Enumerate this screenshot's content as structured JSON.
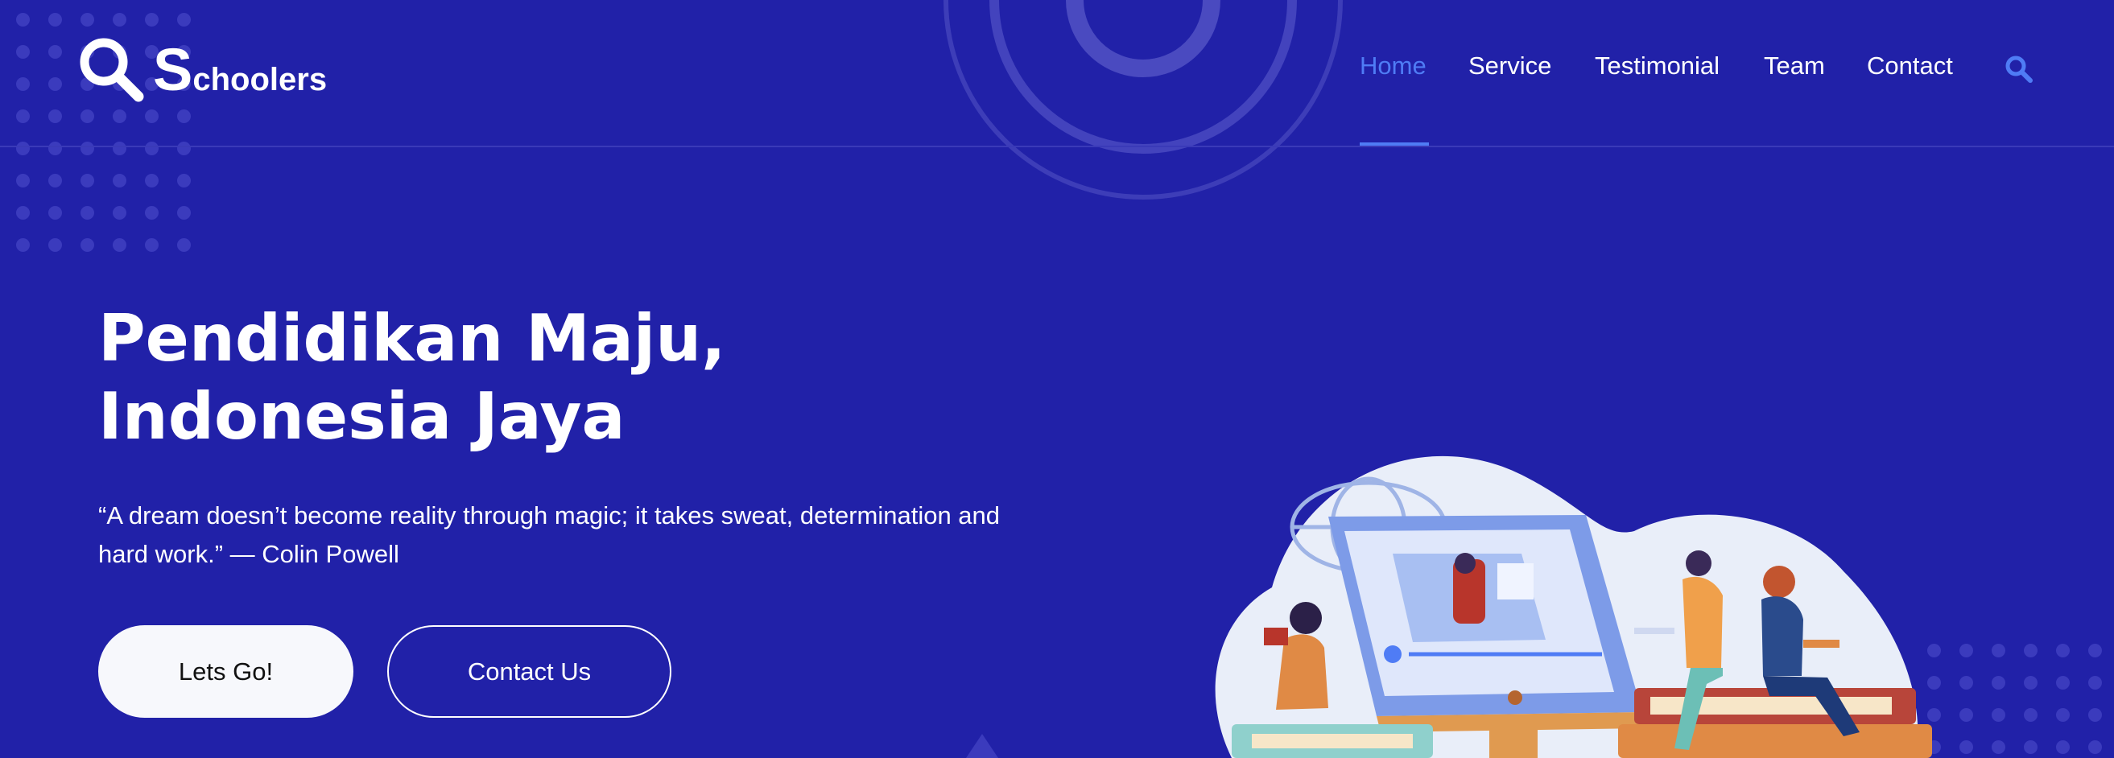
{
  "brand": {
    "logo_initial": "S",
    "logo_rest": "choolers"
  },
  "nav": {
    "items": [
      "Home",
      "Service",
      "Testimonial",
      "Team",
      "Contact"
    ],
    "active": "Home",
    "search_icon": "search-icon"
  },
  "hero": {
    "title": "Pendidikan Maju, Indonesia Jaya",
    "quote": "“A dream doesn’t become reality through magic; it takes sweat, determination and hard work.” — Colin Powell",
    "primary_button": "Lets Go!",
    "secondary_button": "Contact Us"
  },
  "colors": {
    "background": "#2121a8",
    "accent": "#4f7cf5",
    "button_light": "#f7f8fc"
  }
}
